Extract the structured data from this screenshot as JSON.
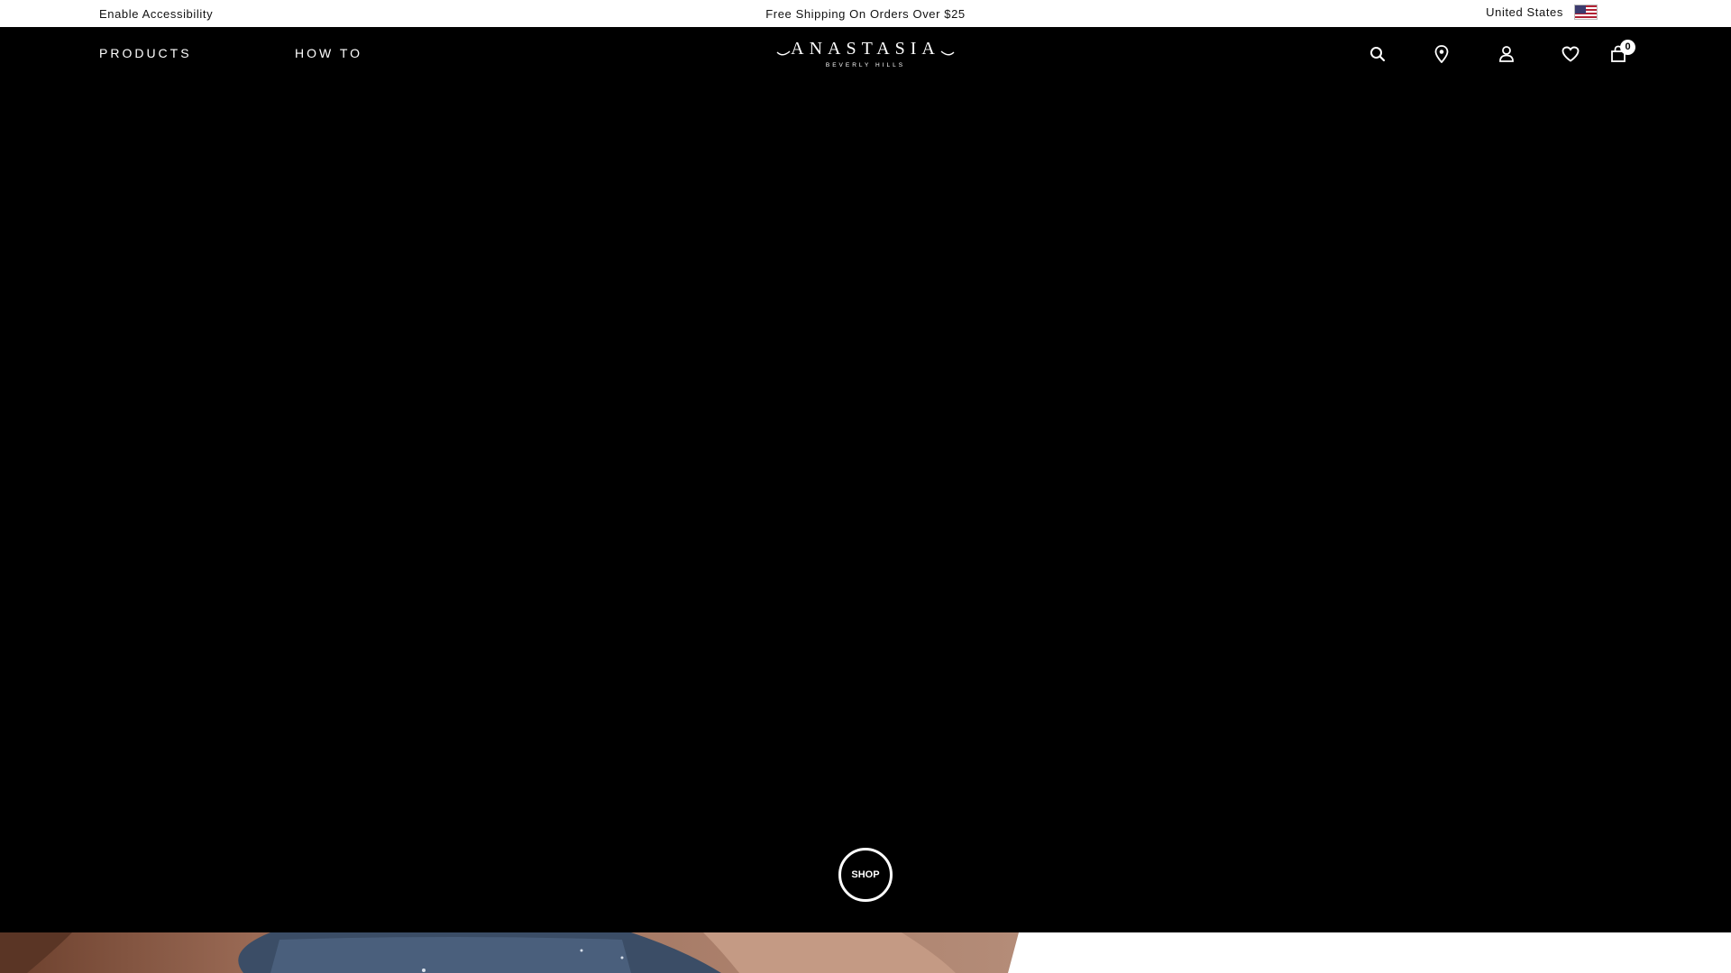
{
  "topbar": {
    "accessibility_label": "Enable Accessibility",
    "promo_text": "Free Shipping On Orders Over $25",
    "country_label": "United States",
    "flag_icon": "us-flag-icon"
  },
  "header": {
    "nav": [
      {
        "label": "PRODUCTS"
      },
      {
        "label": "HOW TO"
      }
    ],
    "logo": {
      "brand": "ANASTASIA",
      "subtitle": "BEVERLY HILLS"
    },
    "icons": [
      "search-icon",
      "store-locator-icon",
      "account-icon",
      "wishlist-icon",
      "cart-icon"
    ],
    "cart_count": "0"
  },
  "hero": {
    "shop_label": "SHOP",
    "background": "#000000"
  },
  "colors": {
    "topbar_bg": "#ffffff",
    "header_bg": "#000000",
    "text_light": "#ffffff"
  }
}
